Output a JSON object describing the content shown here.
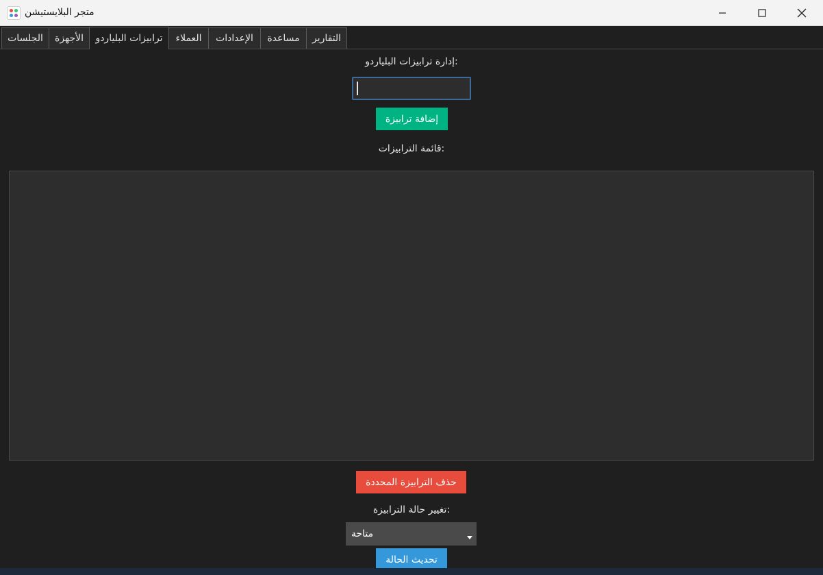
{
  "window": {
    "title": "متجر البلايستيشن",
    "minimize_icon": "minimize-icon",
    "maximize_icon": "maximize-icon",
    "close_icon": "close-icon"
  },
  "tabs": [
    {
      "label": "الجلسات",
      "active": false
    },
    {
      "label": "الأجهزة",
      "active": false
    },
    {
      "label": "ترابيزات البلياردو",
      "active": true
    },
    {
      "label": "العملاء",
      "active": false
    },
    {
      "label": "الإعدادات",
      "active": false
    },
    {
      "label": "مساعدة",
      "active": false
    },
    {
      "label": "التقارير",
      "active": false
    }
  ],
  "billiard": {
    "manage_label": "إدارة ترابيزات البلياردو:",
    "table_name_value": "",
    "add_button": "إضافة ترابيزة",
    "list_label": "قائمة الترابيزات:",
    "delete_button": "حذف الترابيزة المحددة",
    "status_label": "تغيير حالة الترابيزة:",
    "status_selected": "متاحة",
    "update_button": "تحديث الحالة"
  },
  "colors": {
    "add_button": "#00b383",
    "delete_button": "#e74c3c",
    "update_button": "#3498db",
    "background": "#1f1f1f"
  }
}
